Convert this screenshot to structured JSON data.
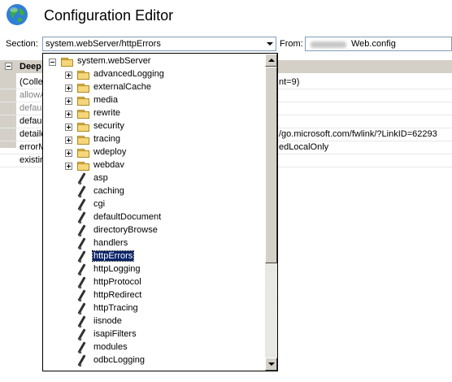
{
  "window": {
    "title": "Configuration Editor",
    "icon": "globe-icon"
  },
  "section_label": "Section:",
  "section_value": "system.webServer/httpErrors",
  "from_label": "From:",
  "from_value": "Web.config",
  "grid": {
    "header": "Deep",
    "rows": [
      {
        "name": "(Colle",
        "value": "nt=9)",
        "gray": false
      },
      {
        "name": "allowA",
        "value": "",
        "gray": true
      },
      {
        "name": "defau",
        "value": "",
        "gray": true
      },
      {
        "name": "defau",
        "value": "",
        "gray": false
      },
      {
        "name": "detaile",
        "value": "/go.microsoft.com/fwlink/?LinkID=62293",
        "gray": false
      },
      {
        "name": "errorM",
        "value": "edLocalOnly",
        "gray": false
      },
      {
        "name": "existir",
        "value": "",
        "gray": false
      }
    ]
  },
  "tree": {
    "root": "system.webServer",
    "folders": [
      "advancedLogging",
      "externalCache",
      "media",
      "rewrite",
      "security",
      "tracing",
      "wdeploy",
      "webdav"
    ],
    "sections": [
      "asp",
      "caching",
      "cgi",
      "defaultDocument",
      "directoryBrowse",
      "handlers",
      "httpErrors",
      "httpLogging",
      "httpProtocol",
      "httpRedirect",
      "httpTracing",
      "iisnode",
      "isapiFilters",
      "modules",
      "odbcLogging"
    ],
    "selected": "httpErrors"
  },
  "colors": {
    "selection": "#0a246a",
    "panel": "#d4d0c8"
  }
}
